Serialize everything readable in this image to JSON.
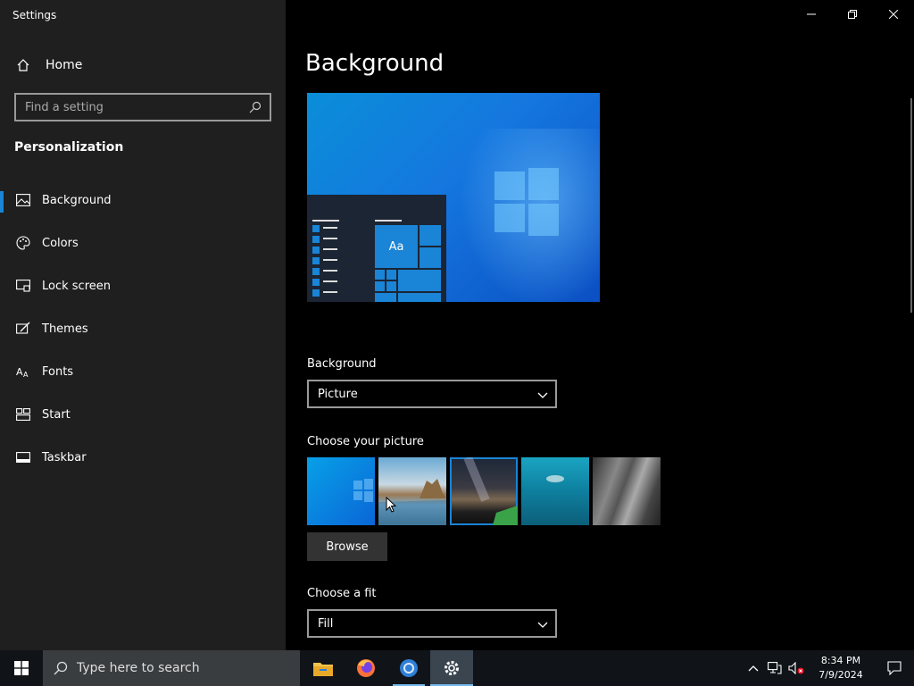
{
  "window": {
    "title": "Settings"
  },
  "sidebar": {
    "home_label": "Home",
    "search_placeholder": "Find a setting",
    "section_title": "Personalization",
    "items": [
      {
        "label": "Background",
        "icon": "picture-icon",
        "active": true
      },
      {
        "label": "Colors",
        "icon": "palette-icon",
        "active": false
      },
      {
        "label": "Lock screen",
        "icon": "lock-screen-icon",
        "active": false
      },
      {
        "label": "Themes",
        "icon": "themes-icon",
        "active": false
      },
      {
        "label": "Fonts",
        "icon": "fonts-icon",
        "active": false
      },
      {
        "label": "Start",
        "icon": "start-icon",
        "active": false
      },
      {
        "label": "Taskbar",
        "icon": "taskbar-icon",
        "active": false
      }
    ]
  },
  "main": {
    "page_title": "Background",
    "preview_tile_text": "Aa",
    "background_label": "Background",
    "background_value": "Picture",
    "choose_picture_label": "Choose your picture",
    "browse_label": "Browse",
    "choose_fit_label": "Choose a fit",
    "fit_value": "Fill"
  },
  "taskbar": {
    "search_placeholder": "Type here to search",
    "apps": [
      "file-explorer-icon",
      "firefox-icon",
      "chromium-icon",
      "settings-icon"
    ],
    "time": "8:34 PM",
    "date": "7/9/2024"
  },
  "colors": {
    "accent": "#1a84d6",
    "sidebar_bg": "#1f1f1f",
    "main_bg": "#000000"
  }
}
